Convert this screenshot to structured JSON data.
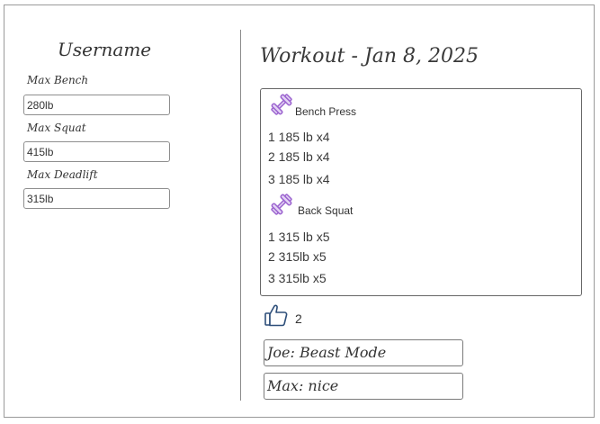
{
  "profile": {
    "username": "Username",
    "fields": [
      {
        "label": "Max Bench",
        "value": "280lb"
      },
      {
        "label": "Max Squat",
        "value": "415lb"
      },
      {
        "label": "Max Deadlift",
        "value": "315lb"
      }
    ]
  },
  "workout": {
    "title": "Workout - Jan 8, 2025",
    "exercises": [
      {
        "icon": "dumbbell-icon",
        "name": "Bench Press",
        "sets": [
          "1 185 lb x4",
          "2 185 lb x4",
          "3 185 lb x4"
        ]
      },
      {
        "icon": "dumbbell-icon",
        "name": "Back Squat",
        "sets": [
          "1 315 lb x5",
          "2 315lb x5",
          "3 315lb x5"
        ]
      }
    ],
    "likes": {
      "icon": "thumbs-up-icon",
      "count": "2"
    },
    "comments": [
      "Joe: Beast Mode",
      "Max: nice"
    ]
  },
  "colors": {
    "dumbbell": "#a774d6",
    "thumbs_up": "#2e4f7a"
  }
}
